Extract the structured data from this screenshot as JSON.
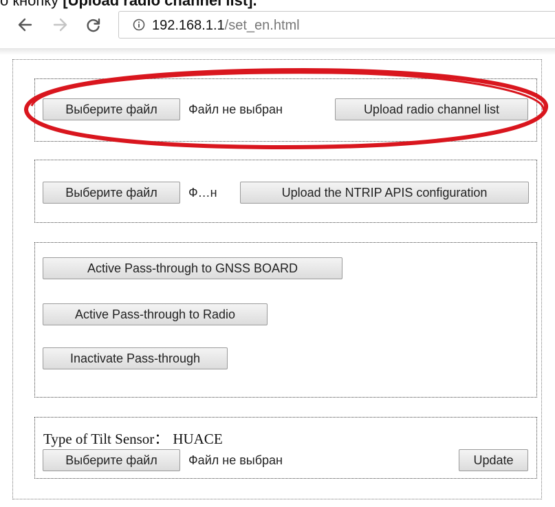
{
  "caption": {
    "prefix": "о кнопку ",
    "bold": "[Upload radio channel list]",
    "suffix": "."
  },
  "browser": {
    "url_host": "192.168.1.1",
    "url_path": "/set_en.html"
  },
  "radio_section": {
    "choose_file_label": "Выберите файл",
    "file_status": "Файл не выбран",
    "upload_label": "Upload radio channel list"
  },
  "ntrip_section": {
    "choose_file_label": "Выберите файл",
    "file_status": "Ф…н",
    "upload_label": "Upload the NTRIP APIS configuration"
  },
  "passthrough_section": {
    "gnss_label": "Active Pass-through to GNSS BOARD",
    "radio_label": "Active Pass-through to Radio",
    "inactivate_label": "Inactivate Pass-through"
  },
  "tilt_section": {
    "type_label": "Type of Tilt Sensor：",
    "type_value": "HUACE",
    "choose_file_label": "Выберите файл",
    "file_status": "Файл не выбран",
    "update_label": "Update"
  },
  "colors": {
    "highlight": "#d9161e"
  }
}
